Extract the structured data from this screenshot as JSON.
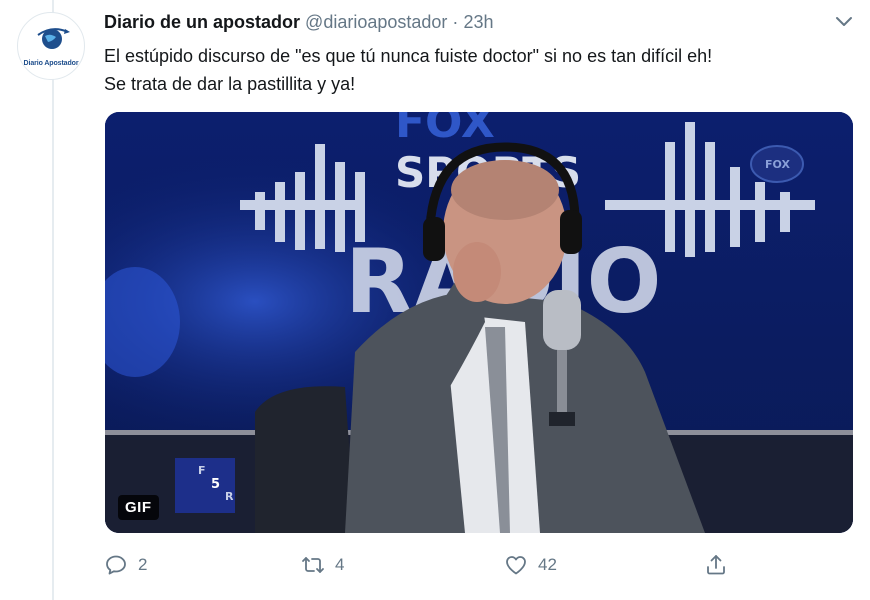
{
  "avatar": {
    "logo_text": "Diario Apostador"
  },
  "tweet": {
    "display_name": "Diario de un apostador",
    "handle": "@diarioapostador",
    "separator": "·",
    "time": "23h",
    "text_lines": [
      "El estúpido discurso de \"es que tú nunca fuiste doctor\"  si no es tan difícil eh!",
      "Se trata de dar la pastillita y ya!"
    ]
  },
  "media": {
    "badge": "GIF",
    "scene_text": {
      "logo_top": "FOX",
      "logo_mid": "SPORTS",
      "logo_bottom": "RADIO",
      "corner": "FOX",
      "desk": [
        "F",
        "5",
        "R"
      ]
    }
  },
  "actions": {
    "reply_count": "2",
    "retweet_count": "4",
    "like_count": "42"
  },
  "icons": {
    "caret": "chevron-down-icon",
    "reply": "reply-icon",
    "retweet": "retweet-icon",
    "like": "heart-icon",
    "share": "share-icon"
  },
  "colors": {
    "text_primary": "#14171a",
    "text_secondary": "#657786",
    "icon": "#657786",
    "logo_blue": "#1e4e8c"
  }
}
